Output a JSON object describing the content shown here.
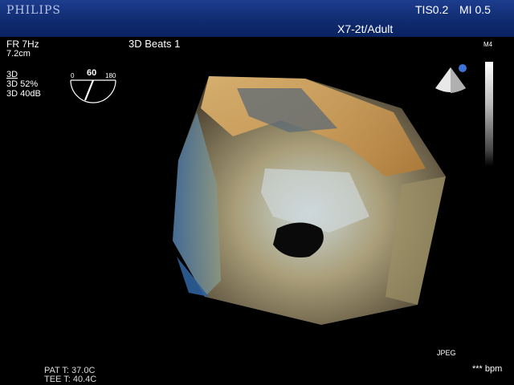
{
  "header": {
    "brand": "PHILIPS",
    "tis": "TIS0.2",
    "mi": "MI 0.5",
    "probe_preset": "X7-2t/Adult"
  },
  "acq": {
    "frame_rate": "FR 7Hz",
    "depth": "7.2cm",
    "beats": "3D Beats 1",
    "mode": "3D",
    "gain": "3D 52%",
    "compress": "3D 40dB"
  },
  "angle": {
    "min": "0",
    "value": "60",
    "max": "180"
  },
  "map_label": "M4",
  "footer": {
    "jpeg": "JPEG",
    "heart_rate": "*** bpm",
    "patient_temp": "PAT T: 37.0C",
    "tee_temp": "TEE T: 40.4C"
  },
  "colors": {
    "topbar": "#0f2a6e",
    "accent_dot": "#3b73d6",
    "tissue_gold": "#d9a85a",
    "tissue_blue": "#6fa4d8"
  },
  "icons": {
    "orientation": "cone-orientation-icon",
    "protractor": "angle-protractor-icon"
  }
}
